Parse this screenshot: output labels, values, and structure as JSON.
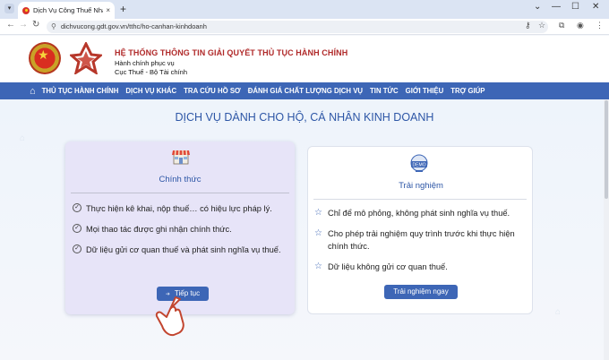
{
  "browser": {
    "tab_title": "Dịch Vụ Công Thuế Nhà Nước",
    "tab_close": "×",
    "new_tab": "+",
    "url": "dichvucong.gdt.gov.vn/tthc/ho-canhan-kinhdoanh",
    "window_controls": [
      "⌄",
      "—",
      "☐",
      "✕"
    ]
  },
  "site": {
    "title": "HỆ THỐNG THÔNG TIN GIẢI QUYẾT THỦ TỤC HÀNH CHÍNH",
    "subtitle1": "Hành chính phục vụ",
    "subtitle2": "Cục Thuế - Bộ Tài chính"
  },
  "menu": {
    "items": [
      "THỦ TỤC HÀNH CHÍNH",
      "DỊCH VỤ KHÁC",
      "TRA CỨU HỒ SƠ",
      "ĐÁNH GIÁ CHẤT LƯỢNG DỊCH VỤ",
      "TIN TỨC",
      "GIỚI THIỆU",
      "TRỢ GIÚP"
    ]
  },
  "main": {
    "heading": "DỊCH VỤ DÀNH CHO HỘ, CÁ NHÂN KINH DOANH",
    "official": {
      "title": "Chính thức",
      "items": [
        "Thực hiện kê khai, nộp thuế… có hiệu lực pháp lý.",
        "Mọi thao tác được ghi nhận chính thức.",
        "Dữ liệu gửi cơ quan thuế và phát sinh nghĩa vụ thuế."
      ],
      "button": "Tiếp tục"
    },
    "trial": {
      "icon_text": "DEMO",
      "title": "Trải nghiệm",
      "items": [
        "Chỉ để mô phỏng, không phát sinh nghĩa vụ thuế.",
        "Cho phép trải nghiệm quy trình trước khi thực hiện chính thức.",
        "Dữ liệu không gửi cơ quan thuế."
      ],
      "button": "Trải nghiệm ngay"
    }
  },
  "colors": {
    "accent": "#3d66b6",
    "title_red": "#b02a2a",
    "card_official_bg": "#e7e4f8"
  }
}
